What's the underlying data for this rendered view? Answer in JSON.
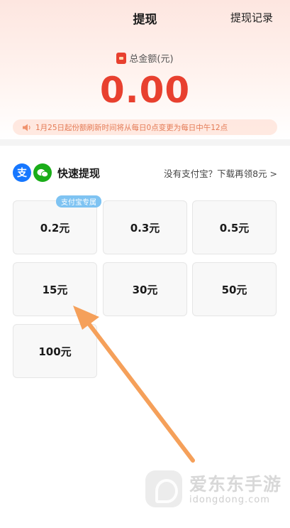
{
  "header": {
    "title": "提现",
    "history_label": "提现记录"
  },
  "balance": {
    "label": "总金额(元)",
    "amount": "0.00"
  },
  "notice": {
    "text": "1月25日起份额刷新时间将从每日0点变更为每日中午12点"
  },
  "method": {
    "icons": [
      "alipay-icon",
      "wechat-icon"
    ],
    "label": "快速提现",
    "download_link": "没有支付宝？下载再领8元 >"
  },
  "options": {
    "badge": "支付宝专属",
    "items": [
      "0.2元",
      "0.3元",
      "0.5元",
      "15元",
      "30元",
      "50元",
      "100元"
    ]
  },
  "watermark": {
    "name": "爱东东手游",
    "domain": "idongdong.com"
  },
  "colors": {
    "accent": "#e8402f",
    "notice_text": "#e47a55",
    "arrow": "#f5a05a",
    "badge": "#7ec3f2"
  }
}
